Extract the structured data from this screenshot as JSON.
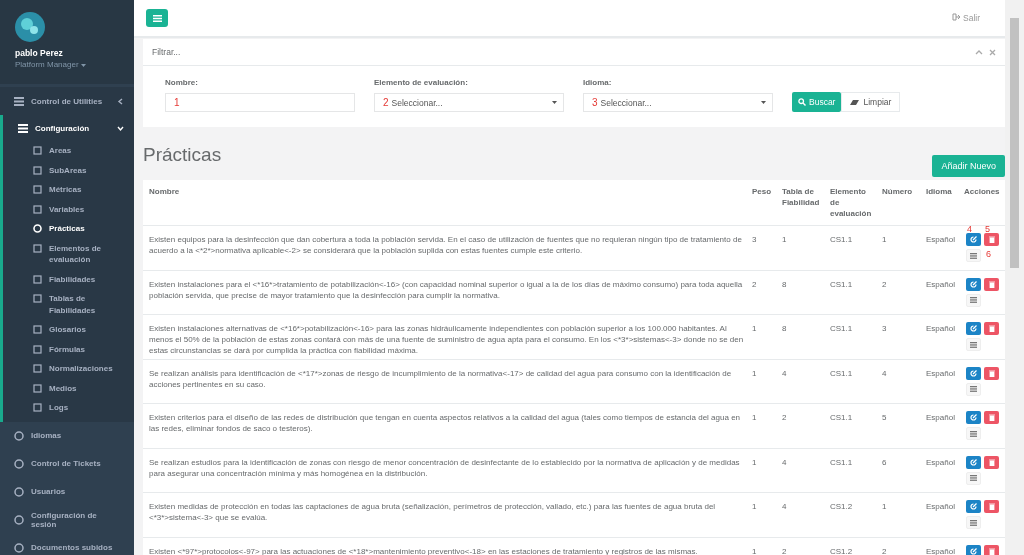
{
  "user": {
    "name": "pablo Perez",
    "role": "Platform Manager"
  },
  "sidebar": {
    "items": [
      {
        "label": "Control de Utilities",
        "expanded": false
      },
      {
        "label": "Configuración",
        "expanded": true,
        "children": [
          {
            "label": "Areas",
            "selected": false
          },
          {
            "label": "SubAreas",
            "selected": false
          },
          {
            "label": "Métricas",
            "selected": false
          },
          {
            "label": "Variables",
            "selected": false
          },
          {
            "label": "Prácticas",
            "selected": true
          },
          {
            "label": "Elementos de evaluación",
            "selected": false
          },
          {
            "label": "Fiabilidades",
            "selected": false
          },
          {
            "label": "Tablas de Fiabilidades",
            "selected": false
          },
          {
            "label": "Glosarios",
            "selected": false
          },
          {
            "label": "Fórmulas",
            "selected": false
          },
          {
            "label": "Normalizaciones",
            "selected": false
          },
          {
            "label": "Medios",
            "selected": false
          },
          {
            "label": "Logs",
            "selected": false
          }
        ]
      },
      {
        "label": "Idiomas"
      },
      {
        "label": "Control de Tickets"
      },
      {
        "label": "Usuarios"
      },
      {
        "label": "Configuración de sesión"
      },
      {
        "label": "Documentos subidos"
      }
    ]
  },
  "topbar": {
    "logout": "Salir"
  },
  "filter": {
    "title": "Filtrar...",
    "fields": [
      {
        "label": "Nombre:",
        "kind": "text",
        "mark": "1"
      },
      {
        "label": "Elemento de evaluación:",
        "kind": "select",
        "placeholder": "Seleccionar...",
        "mark": "2"
      },
      {
        "label": "Idioma:",
        "kind": "select",
        "placeholder": "Seleccionar...",
        "mark": "3"
      }
    ],
    "search_button": "Buscar",
    "clear_button": "Limpiar"
  },
  "page_title": "Prácticas",
  "add_button": "Añadir Nuevo",
  "table": {
    "columns": [
      "Nombre",
      "Peso",
      "Tabla de Fiabilidad",
      "Elemento de evaluación",
      "Número",
      "Idioma",
      "Acciones"
    ],
    "action_marks": [
      "4",
      "5",
      "6"
    ],
    "rows": [
      [
        "Existen equipos para la desinfección que dan cobertura a toda la población servida. En el caso de utilización de fuentes que no requieran ningún tipo de tratamiento de acuerdo a la <*2*>normativa aplicable<-2> se considerará que la población suplida con estas fuentes cumple este criterio.",
        "3",
        "1",
        "CS1.1",
        "1",
        "Español"
      ],
      [
        "Existen instalaciones para el <*16*>tratamiento de potabilización<-16> (con capacidad nominal superior o igual a la de los días de máximo consumo) para toda aquella población servida, que precise de mayor tratamiento que la desinfección para cumplir la normativa.",
        "2",
        "8",
        "CS1.1",
        "2",
        "Español"
      ],
      [
        "Existen instalaciones alternativas de <*16*>potabilización<-16> para las zonas hidráulicamente independientes con población superior a los 100.000 habitantes. Al menos el 50% de la población de estas zonas contará con más de una fuente de suministro de agua apta para el consumo. En los <*3*>sistemas<-3> donde no se den estas circunstancias se dará por cumplida la práctica con fiabilidad máxima.",
        "1",
        "8",
        "CS1.1",
        "3",
        "Español"
      ],
      [
        "Se realizan análisis para identificación de <*17*>zonas de riesgo de incumplimiento de la normativa<-17> de calidad del agua para consumo con la identificación de acciones pertinentes en su caso.",
        "1",
        "4",
        "CS1.1",
        "4",
        "Español"
      ],
      [
        "Existen criterios para el diseño de las redes de distribución que tengan en cuenta aspectos relativos a la calidad del agua (tales como tiempos de estancia del agua en las redes, eliminar fondos de saco o testeros).",
        "1",
        "2",
        "CS1.1",
        "5",
        "Español"
      ],
      [
        "Se realizan estudios para la identificación de zonas con riesgo de menor concentración de desinfectante de lo establecido por la normativa de aplicación y de medidas para asegurar una concentración mínima y más homogénea en la distribución.",
        "1",
        "4",
        "CS1.1",
        "6",
        "Español"
      ],
      [
        "Existen medidas de protección en todas las captaciones de agua bruta (señalización, perímetros de protección, vallado, etc.) para las fuentes de agua bruta del <*3*>sistema<-3> que se evalúa.",
        "1",
        "4",
        "CS1.2",
        "1",
        "Español"
      ],
      [
        "Existen <*97*>protocolos<-97> para las actuaciones de <*18*>mantenimiento preventivo<-18> en las estaciones de tratamiento y registros de las mismas.",
        "1",
        "2",
        "CS1.2",
        "2",
        "Español"
      ]
    ]
  }
}
